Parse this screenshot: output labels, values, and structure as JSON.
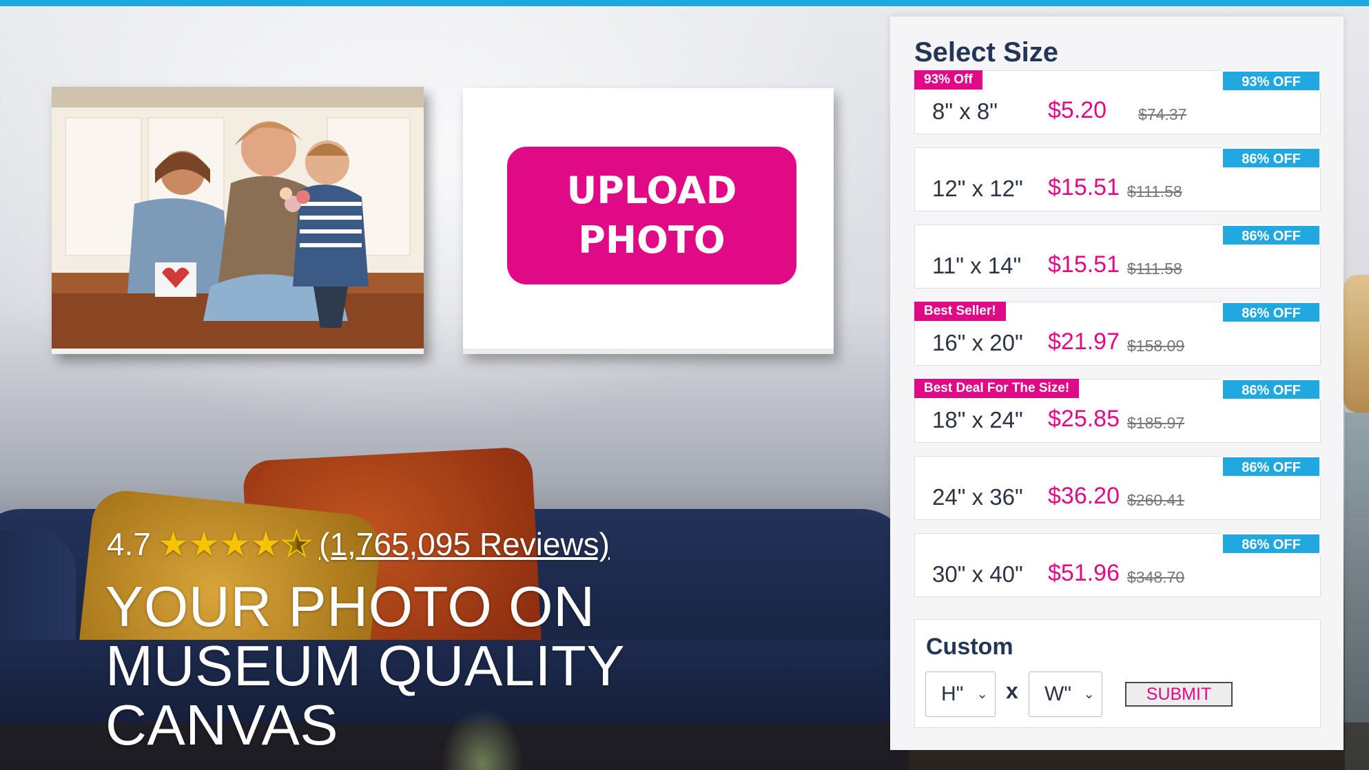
{
  "hero": {
    "upload_line1": "UPLOAD",
    "upload_line2": "PHOTO",
    "rating_value": "4.7",
    "stars": 4.5,
    "reviews_link": "(1,765,095 Reviews)",
    "headline_line1": "YOUR PHOTO ON",
    "headline_line2": "MUSEUM QUALITY",
    "headline_line3": "CANVAS"
  },
  "panel": {
    "title": "Select Size",
    "sizes": [
      {
        "size": "8\" x 8\"",
        "price": "$5.20",
        "old_price": "$74.37",
        "off": "93% OFF",
        "tag": "93% Off"
      },
      {
        "size": "12\" x 12\"",
        "price": "$15.51",
        "old_price": "$111.58",
        "off": "86% OFF",
        "tag": ""
      },
      {
        "size": "11\" x 14\"",
        "price": "$15.51",
        "old_price": "$111.58",
        "off": "86% OFF",
        "tag": ""
      },
      {
        "size": "16\" x 20\"",
        "price": "$21.97",
        "old_price": "$158.09",
        "off": "86% OFF",
        "tag": "Best Seller!"
      },
      {
        "size": "18\" x 24\"",
        "price": "$25.85",
        "old_price": "$185.97",
        "off": "86% OFF",
        "tag": "Best Deal For The Size!"
      },
      {
        "size": "24\" x 36\"",
        "price": "$36.20",
        "old_price": "$260.41",
        "off": "86% OFF",
        "tag": ""
      },
      {
        "size": "30\" x 40\"",
        "price": "$51.96",
        "old_price": "$348.70",
        "off": "86% OFF",
        "tag": ""
      }
    ],
    "custom": {
      "title": "Custom",
      "height_value": "H\"",
      "width_value": "W\"",
      "times": "x",
      "submit": "SUBMIT"
    }
  },
  "colors": {
    "accent_pink": "#e10a86",
    "badge_blue": "#21a8e0",
    "navy": "#233655",
    "top_bar": "#1fa7e0"
  }
}
